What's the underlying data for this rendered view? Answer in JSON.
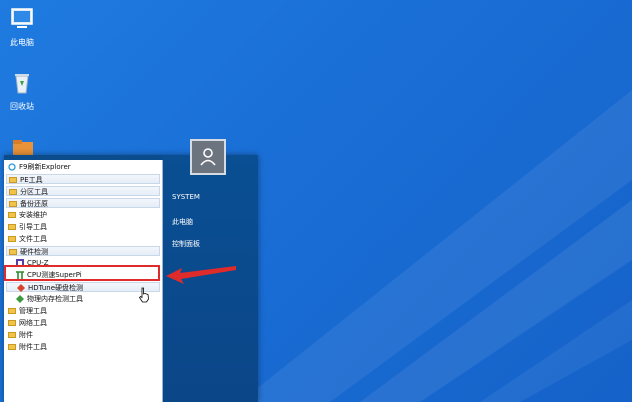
{
  "desktop": {
    "icons": [
      {
        "label": "此电脑",
        "icon": "computer-icon"
      },
      {
        "label": "回收站",
        "icon": "recycle-bin-icon"
      },
      {
        "label": "",
        "icon": "folder-icon"
      }
    ]
  },
  "start_menu": {
    "top_item": "F9刷新Explorer",
    "items": [
      {
        "label": "PE工具",
        "type": "folder"
      },
      {
        "label": "分区工具",
        "type": "folder"
      },
      {
        "label": "备份还原",
        "type": "folder"
      },
      {
        "label": "安装维护",
        "type": "folder"
      },
      {
        "label": "引导工具",
        "type": "folder"
      },
      {
        "label": "文件工具",
        "type": "folder"
      },
      {
        "label": "硬件检测",
        "type": "folder"
      },
      {
        "label": "CPU-Z",
        "type": "app"
      },
      {
        "label": "CPU测速SuperPi",
        "type": "app"
      },
      {
        "label": "HDTune硬盘检测",
        "type": "app"
      },
      {
        "label": "物理内存检测工具",
        "type": "app"
      },
      {
        "label": "管理工具",
        "type": "folder"
      },
      {
        "label": "网络工具",
        "type": "folder"
      },
      {
        "label": "附件",
        "type": "folder"
      },
      {
        "label": "附件工具",
        "type": "folder"
      }
    ],
    "right_items": [
      "SYSTEM",
      "此电脑",
      "控制面板"
    ]
  },
  "colors": {
    "highlight": "#e02b2b",
    "desktop": "#1a6fd6"
  }
}
